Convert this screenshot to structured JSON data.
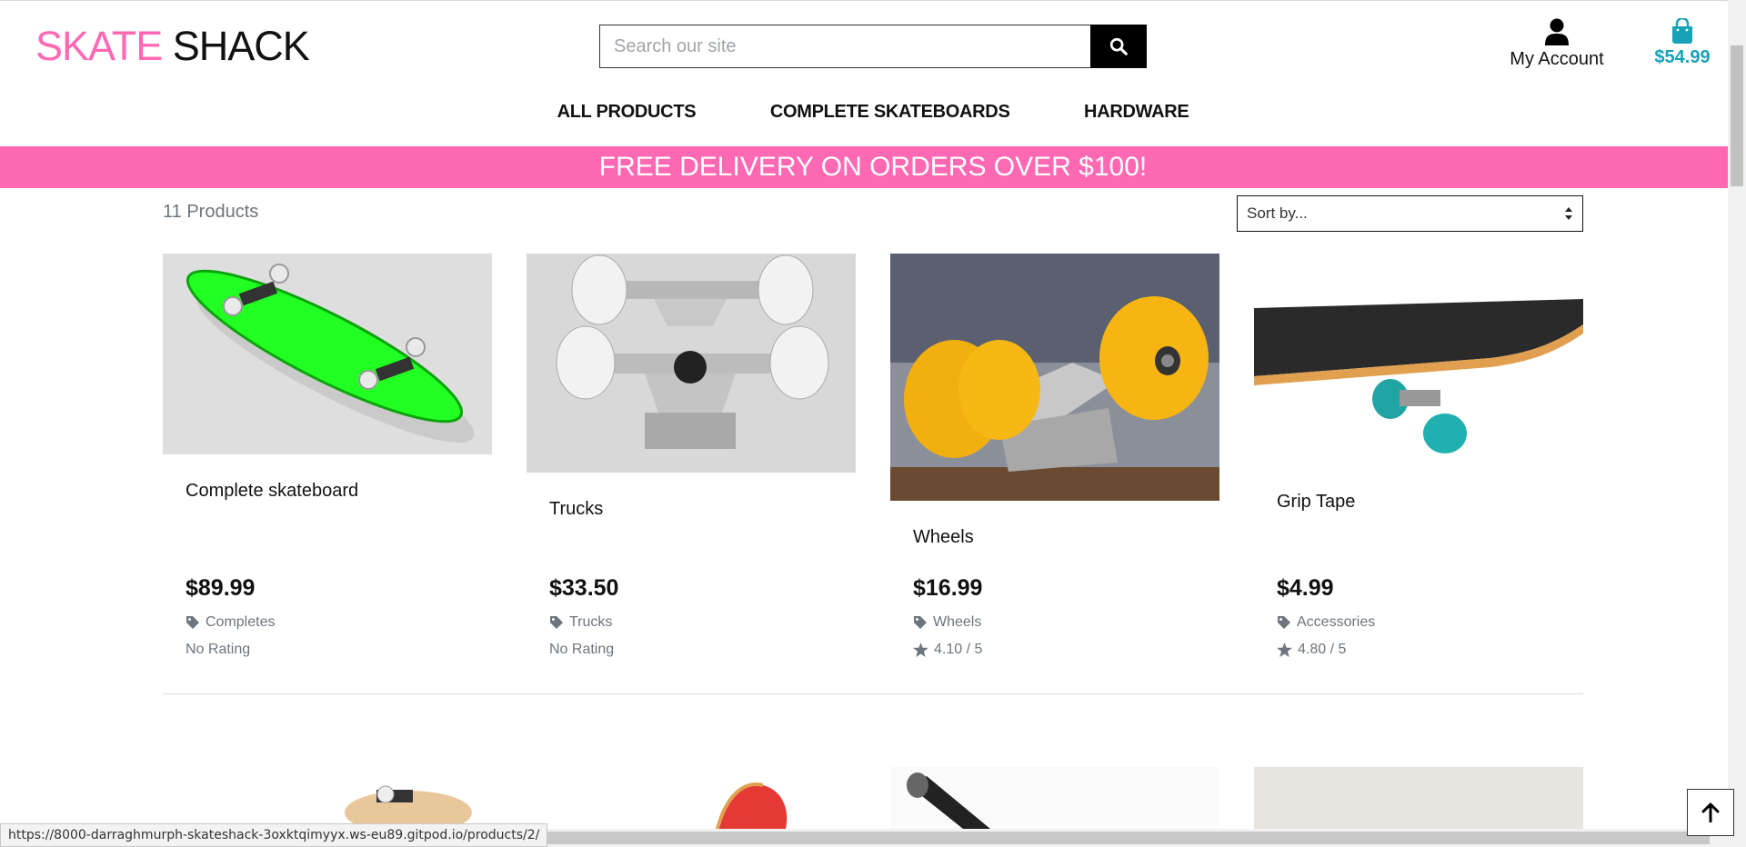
{
  "header": {
    "logo_part1": "SKATE",
    "logo_part2": "SHACK",
    "search_placeholder": "Search our site",
    "account_label": "My Account",
    "cart_total": "$54.99"
  },
  "nav": {
    "items": [
      "ALL PRODUCTS",
      "COMPLETE SKATEBOARDS",
      "HARDWARE"
    ]
  },
  "banner": {
    "text": "FREE DELIVERY ON ORDERS OVER $100!"
  },
  "toolbar": {
    "count": "11 Products",
    "sort_label": "Sort by..."
  },
  "products": [
    {
      "name": "Complete skateboard",
      "price": "$89.99",
      "category": "Completes",
      "rating": "No Rating"
    },
    {
      "name": "Trucks",
      "price": "$33.50",
      "category": "Trucks",
      "rating": "No Rating"
    },
    {
      "name": "Wheels",
      "price": "$16.99",
      "category": "Wheels",
      "rating": "4.10 / 5"
    },
    {
      "name": "Grip Tape",
      "price": "$4.99",
      "category": "Accessories",
      "rating": "4.80 / 5"
    }
  ],
  "status_url": "https://8000-darraghmurph-skateshack-3oxktqimyyx.ws-eu89.gitpod.io/products/2/",
  "colors": {
    "brand_pink": "#ff69b4",
    "cart_teal": "#17a2b8",
    "muted": "#6c757d"
  },
  "icons": {
    "search": "search-icon",
    "account": "user-icon",
    "cart": "shopping-bag-icon",
    "category": "tag-icon",
    "rating": "star-icon",
    "back_to_top": "arrow-up-icon"
  }
}
